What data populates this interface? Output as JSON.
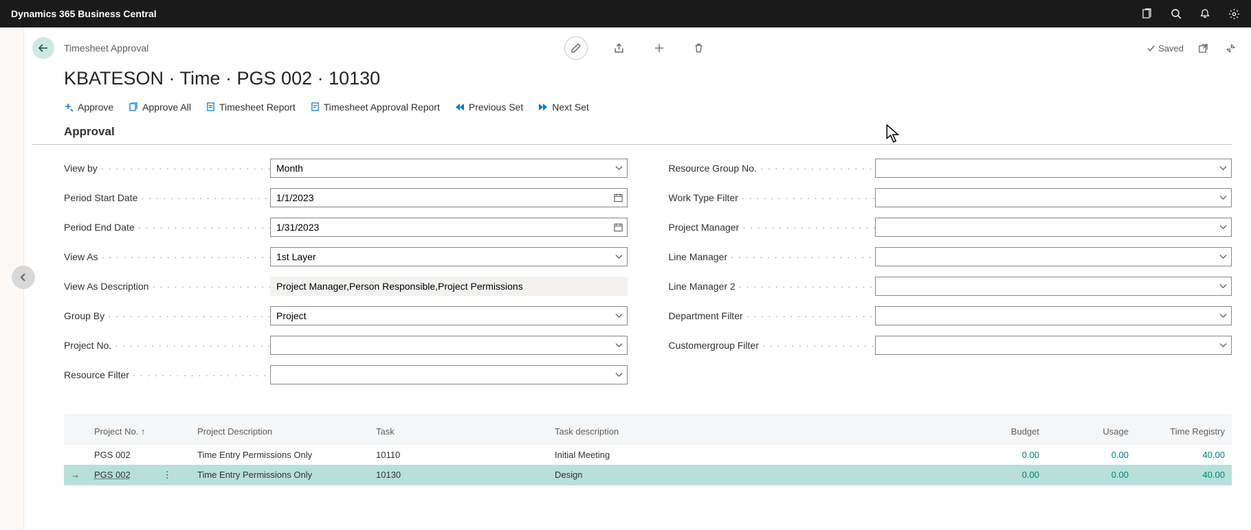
{
  "app": {
    "title": "Dynamics 365 Business Central"
  },
  "header": {
    "crumb": "Timesheet Approval",
    "page_title": "KBATESON · Time · PGS 002 · 10130",
    "saved_label": "Saved"
  },
  "actions": {
    "approve": "Approve",
    "approve_all": "Approve All",
    "timesheet_report": "Timesheet Report",
    "timesheet_approval_report": "Timesheet Approval Report",
    "previous_set": "Previous Set",
    "next_set": "Next Set"
  },
  "section": {
    "title": "Approval"
  },
  "form": {
    "left": {
      "view_by": {
        "label": "View by",
        "value": "Month"
      },
      "period_start": {
        "label": "Period Start Date",
        "value": "1/1/2023"
      },
      "period_end": {
        "label": "Period End Date",
        "value": "1/31/2023"
      },
      "view_as": {
        "label": "View As",
        "value": "1st Layer"
      },
      "view_as_desc": {
        "label": "View As Description",
        "value": "Project Manager,Person Responsible,Project Permissions"
      },
      "group_by": {
        "label": "Group By",
        "value": "Project"
      },
      "project_no": {
        "label": "Project No.",
        "value": ""
      },
      "resource_filter": {
        "label": "Resource Filter",
        "value": ""
      }
    },
    "right": {
      "resource_group_no": {
        "label": "Resource Group No.",
        "value": ""
      },
      "work_type_filter": {
        "label": "Work Type Filter",
        "value": ""
      },
      "project_manager": {
        "label": "Project Manager",
        "value": ""
      },
      "line_manager": {
        "label": "Line Manager",
        "value": ""
      },
      "line_manager_2": {
        "label": "Line Manager 2",
        "value": ""
      },
      "department_filter": {
        "label": "Department Filter",
        "value": ""
      },
      "customergroup_filter": {
        "label": "Customergroup Filter",
        "value": ""
      }
    }
  },
  "grid": {
    "columns": {
      "project_no": "Project No. ↑",
      "project_desc": "Project Description",
      "task": "Task",
      "task_desc": "Task description",
      "budget": "Budget",
      "usage": "Usage",
      "time_registry": "Time Registry"
    },
    "rows": [
      {
        "project_no": "PGS 002",
        "project_desc": "Time Entry Permissions Only",
        "task": "10110",
        "task_desc": "Initial Meeting",
        "budget": "0.00",
        "usage": "0.00",
        "time_registry": "40.00",
        "selected": false
      },
      {
        "project_no": "PGS 002",
        "project_desc": "Time Entry Permissions Only",
        "task": "10130",
        "task_desc": "Design",
        "budget": "0.00",
        "usage": "0.00",
        "time_registry": "40.00",
        "selected": true
      }
    ]
  }
}
